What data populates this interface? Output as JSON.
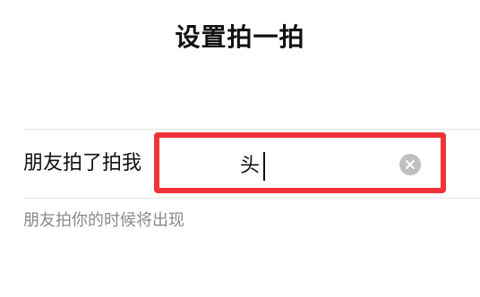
{
  "page": {
    "title": "设置拍一拍"
  },
  "pat_setting": {
    "label": "朋友拍了拍我",
    "input_value": "头",
    "helper_text": "朋友拍你的时候将出现"
  },
  "icons": {
    "clear": "close-circle-icon"
  },
  "colors": {
    "highlight_border": "#f0333a",
    "clear_icon_bg": "#bfbfbf",
    "helper_text": "#8a8a8a"
  }
}
